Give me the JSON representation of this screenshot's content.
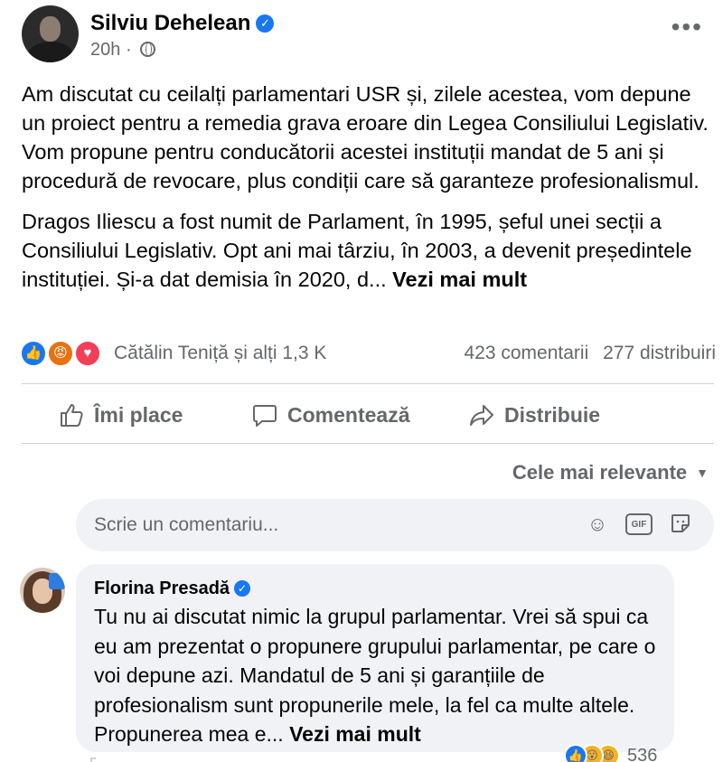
{
  "post": {
    "author": "Silviu Dehelean",
    "time": "20h",
    "time_separator": "·",
    "paragraph1": "Am discutat cu ceilalți parlamentari USR și, zilele acestea, vom depune un proiect pentru a remedia grava eroare din Legea Consiliului Legislativ. Vom propune pentru conducătorii acestei instituții mandat de 5 ani și procedură de revocare, plus condiții care să garanteze profesionalismul.",
    "paragraph2": "Dragos Iliescu a fost numit de Parlament, în 1995, șeful unei secții a Consiliului Legislativ.  Opt ani mai târziu, în 2003, a devenit președintele instituției. Și-a dat demisia în 2020, d...",
    "see_more": "Vezi mai mult"
  },
  "reactions": {
    "icons": [
      "like-icon",
      "angry-icon",
      "love-icon"
    ],
    "names": "Cătălin Teniță și alți 1,3 K",
    "comments": "423 comentarii",
    "shares": "277 distribuiri"
  },
  "actions": {
    "like": "Îmi place",
    "comment": "Comentează",
    "share": "Distribuie"
  },
  "sort": {
    "label": "Cele mai relevante"
  },
  "comment_input": {
    "placeholder": "Scrie un comentariu...",
    "gif_label": "GIF"
  },
  "top_comment": {
    "author": "Florina Presadă",
    "text": "Tu nu ai discutat nimic la grupul parlamentar. Vrei să spui ca eu am prezentat o propunere grupului parlamentar, pe care o voi depune azi. Mandatul de 5 ani și garanțiile de profesionalism sunt propunerile mele, la fel ca multe altele. Propunerea mea e...",
    "see_more": "Vezi mai mult",
    "reaction_count": "536"
  },
  "colors": {
    "accent": "#1877f2",
    "secondary_text": "#65676b",
    "bubble_bg": "#f0f2f5"
  }
}
